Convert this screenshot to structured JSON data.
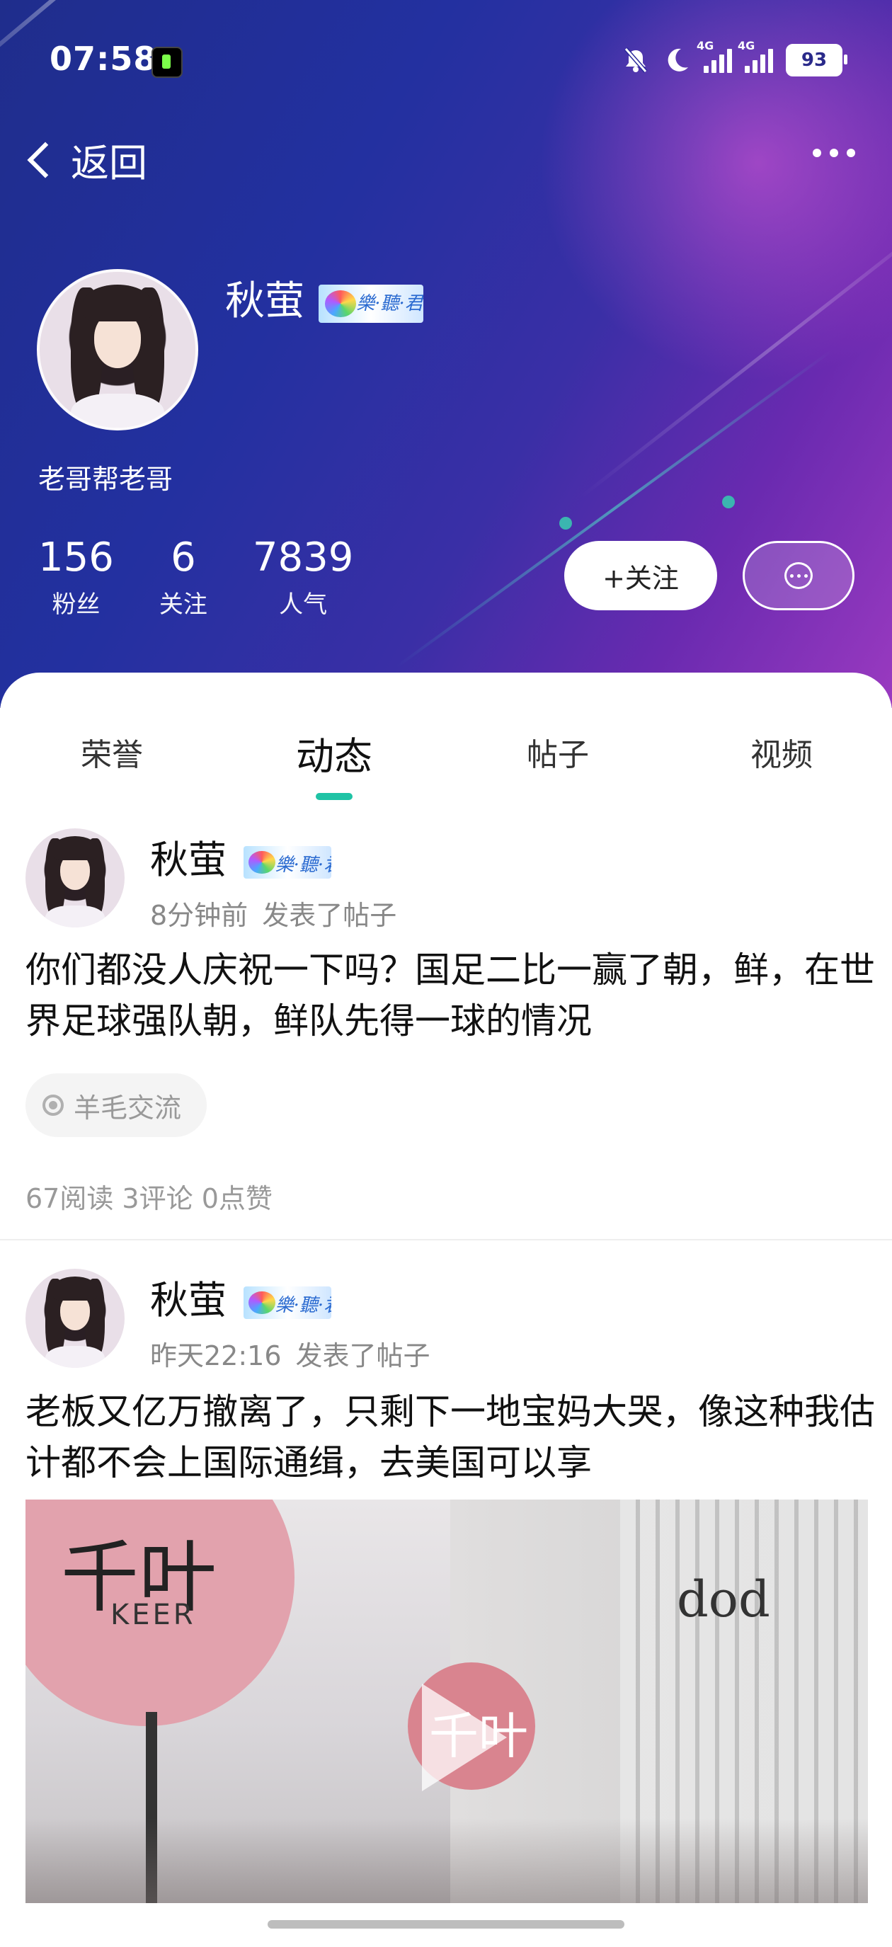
{
  "status_bar": {
    "time": "07:58",
    "network_1": "4G",
    "network_2": "4G",
    "battery": "93",
    "icons": [
      "app-notification-icon",
      "mute-bell-icon",
      "moon-icon",
      "signal-icon",
      "signal-icon",
      "battery-icon"
    ]
  },
  "nav": {
    "back_label": "返回",
    "more_icon": "more-dots-icon"
  },
  "profile": {
    "name": "秋萤",
    "badge_text": "樂·聽·君",
    "bio": "老哥帮老哥",
    "stats": [
      {
        "value": "156",
        "label": "粉丝"
      },
      {
        "value": "6",
        "label": "关注"
      },
      {
        "value": "7839",
        "label": "人气"
      }
    ],
    "follow_label": "+关注",
    "message_icon": "chat-bubble-icon"
  },
  "tabs": [
    {
      "label": "荣誉",
      "active": false
    },
    {
      "label": "动态",
      "active": true
    },
    {
      "label": "帖子",
      "active": false
    },
    {
      "label": "视频",
      "active": false
    }
  ],
  "posts": [
    {
      "author": "秋萤",
      "time": "8分钟前",
      "action": "发表了帖子",
      "text": "你们都没人庆祝一下吗？国足二比一赢了朝，鲜，在世界足球强队朝，鲜队先得一球的情况",
      "tag": "羊毛交流",
      "stats": "67阅读 3评论 0点赞"
    },
    {
      "author": "秋萤",
      "time": "昨天22:16",
      "action": "发表了帖子",
      "text": "老板又亿万撤离了，只剩下一地宝妈大哭，像这种我估计都不会上国际通缉，去美国可以享",
      "video": {
        "sign_text": "千叶",
        "sign_sub": "KEER",
        "door_text": "dod"
      }
    }
  ],
  "colors": {
    "accent": "#1fc3a5",
    "hero_start": "#1f2d8c",
    "hero_end": "#9a3ac0"
  }
}
